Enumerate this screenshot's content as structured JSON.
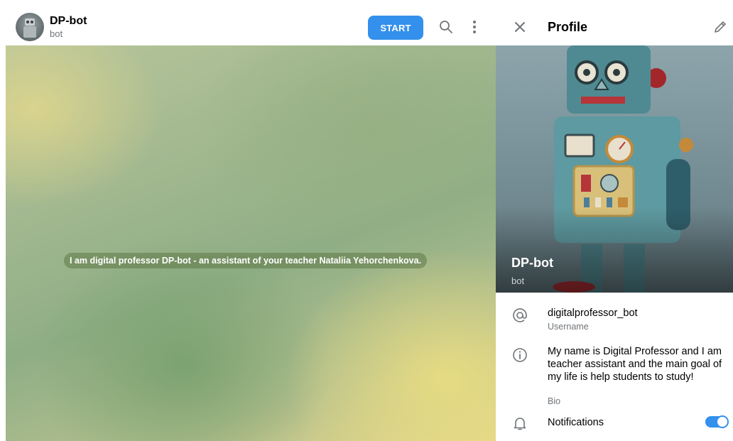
{
  "chat": {
    "title": "DP-bot",
    "subtitle": "bot",
    "start_label": "START",
    "service_message": "I am digital professor DP-bot - an assistant of your teacher Nataliia Yehorchenkova."
  },
  "profile": {
    "header_title": "Profile",
    "name": "DP-bot",
    "subtitle": "bot",
    "username": "digitalprofessor_bot",
    "username_label": "Username",
    "bio": "My name is Digital Professor and I am teacher assistant and the main goal of my life is help students to study!",
    "bio_label": "Bio",
    "notifications_label": "Notifications",
    "notifications_enabled": true
  },
  "colors": {
    "accent": "#3390ec",
    "secondary_text": "#707579"
  },
  "icons": [
    "search-icon",
    "more-vertical-icon",
    "close-icon",
    "edit-icon",
    "at-icon",
    "info-icon",
    "bell-icon"
  ]
}
